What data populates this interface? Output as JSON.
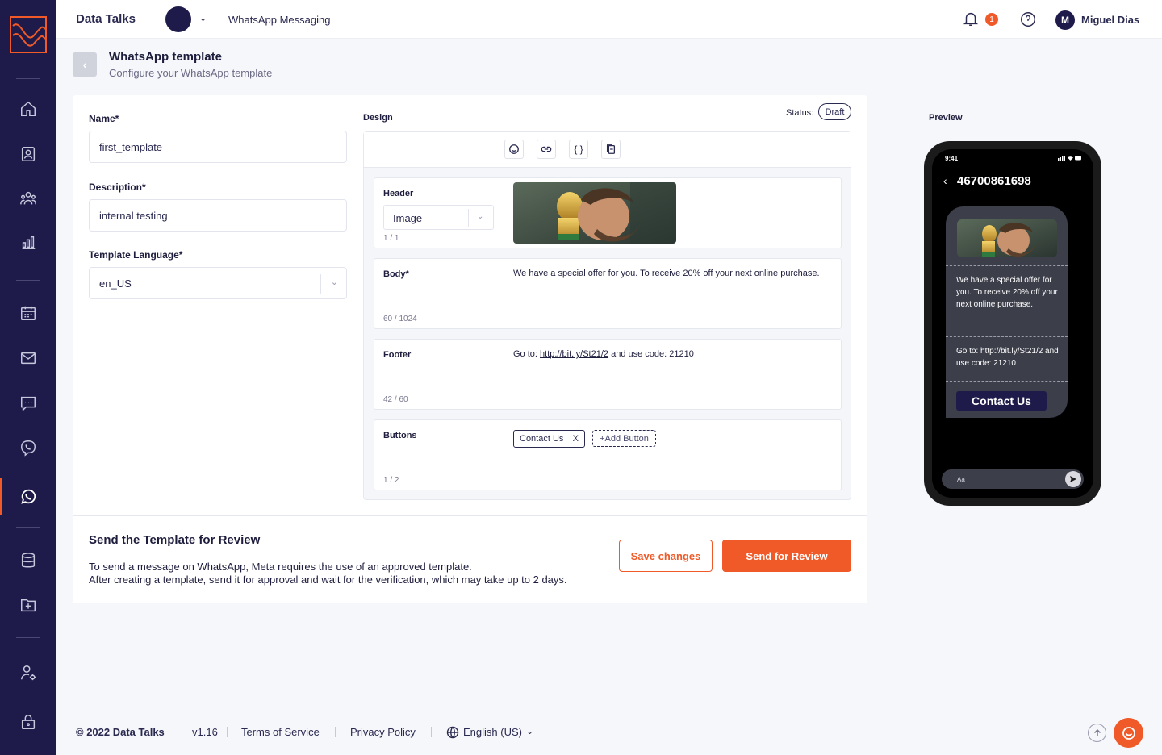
{
  "app": {
    "brand": "Data Talks",
    "workspace": "WhatsApp Messaging",
    "notifications_count": "1",
    "user_initial": "M",
    "user_name": "Miguel Dias"
  },
  "sidebar": {
    "icons": [
      "home-icon",
      "contacts-icon",
      "audience-icon",
      "analytics-icon",
      "calendar-icon",
      "email-icon",
      "sms-icon",
      "viber-icon",
      "whatsapp-icon",
      "database-icon",
      "folder-add-icon",
      "user-settings-icon",
      "lock-icon"
    ],
    "active": "whatsapp-icon"
  },
  "page": {
    "title": "WhatsApp template",
    "subtitle": "Configure your WhatsApp template"
  },
  "form": {
    "name_label": "Name*",
    "name_value": "first_template",
    "description_label": "Description*",
    "description_value": "internal testing",
    "language_label": "Template Language*",
    "language_value": "en_US"
  },
  "design": {
    "label": "Design",
    "status_label": "Status:",
    "status_value": "Draft",
    "toolbar": [
      "emoji-icon",
      "link-icon",
      "variable-icon",
      "copy-icon"
    ],
    "toolbar_variable_glyph": "{ }",
    "header": {
      "title": "Header",
      "type": "Image",
      "count": "1 / 1"
    },
    "body": {
      "title": "Body*",
      "text": "We have a special offer for you. To receive 20% off your next online purchase.",
      "count": "60 / 1024"
    },
    "footer": {
      "title": "Footer",
      "text_before": "Go to: ",
      "link": "http://bit.ly/St21/2",
      "text_after": " and use code: 21210",
      "count": "42 / 60"
    },
    "buttons": {
      "title": "Buttons",
      "chip": "Contact Us",
      "chip_remove": "X",
      "add": "+Add Button",
      "count": "1 / 2"
    }
  },
  "review": {
    "title": "Send the Template for Review",
    "line1": "To send a message on WhatsApp, Meta requires the use of an approved template.",
    "line2": "After creating a template, send it for approval and wait for the verification, which may take up to 2 days.",
    "save_label": "Save changes",
    "send_label": "Send for Review"
  },
  "preview": {
    "label": "Preview",
    "time": "9:41",
    "phone_number": "46700861698",
    "body": "We have a special offer for you. To receive 20% off your next online purchase.",
    "footer": "Go to: http://bit.ly/St21/2 and use code: 21210",
    "button": "Contact Us",
    "input_placeholder": "Aa"
  },
  "footer": {
    "copyright": "© 2022 Data Talks",
    "version": "v1.16",
    "terms": "Terms of Service",
    "privacy": "Privacy Policy",
    "language": "English (US)"
  },
  "colors": {
    "sidebar": "#1e1b4b",
    "accent": "#f05a28",
    "background": "#f6f7fb"
  }
}
